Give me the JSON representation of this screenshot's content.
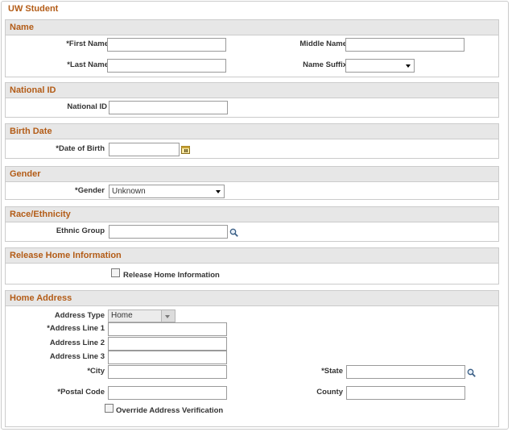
{
  "page": {
    "title": "UW Student"
  },
  "name_section": {
    "title": "Name",
    "first_name_label": "*First Name",
    "first_name_value": "",
    "middle_name_label": "Middle Name",
    "middle_name_value": "",
    "last_name_label": "*Last Name",
    "last_name_value": "",
    "name_suffix_label": "Name Suffix",
    "name_suffix_value": ""
  },
  "national_id_section": {
    "title": "National ID",
    "national_id_label": "National ID",
    "national_id_value": ""
  },
  "birth_section": {
    "title": "Birth Date",
    "dob_label": "*Date of Birth",
    "dob_value": "",
    "calendar_icon": "calendar-icon"
  },
  "gender_section": {
    "title": "Gender",
    "gender_label": "*Gender",
    "gender_value": "Unknown"
  },
  "race_section": {
    "title": "Race/Ethnicity",
    "ethnic_group_label": "Ethnic Group",
    "ethnic_group_value": "",
    "lookup_icon": "search-icon"
  },
  "release_section": {
    "title": "Release Home Information",
    "checkbox_label": "Release Home Information",
    "checked": false
  },
  "address_section": {
    "title": "Home Address",
    "address_type_label": "Address Type",
    "address_type_value": "Home",
    "line1_label": "*Address Line 1",
    "line2_label": "Address Line 2",
    "line3_label": "Address Line 3",
    "city_label": "*City",
    "state_label": "*State",
    "postal_label": "*Postal Code",
    "county_label": "County",
    "override_label": "Override Address Verification",
    "override_checked": false
  },
  "colors": {
    "section_title": "#b35c17",
    "header_bg": "#e7e7e7",
    "border": "#cbcbcb"
  }
}
